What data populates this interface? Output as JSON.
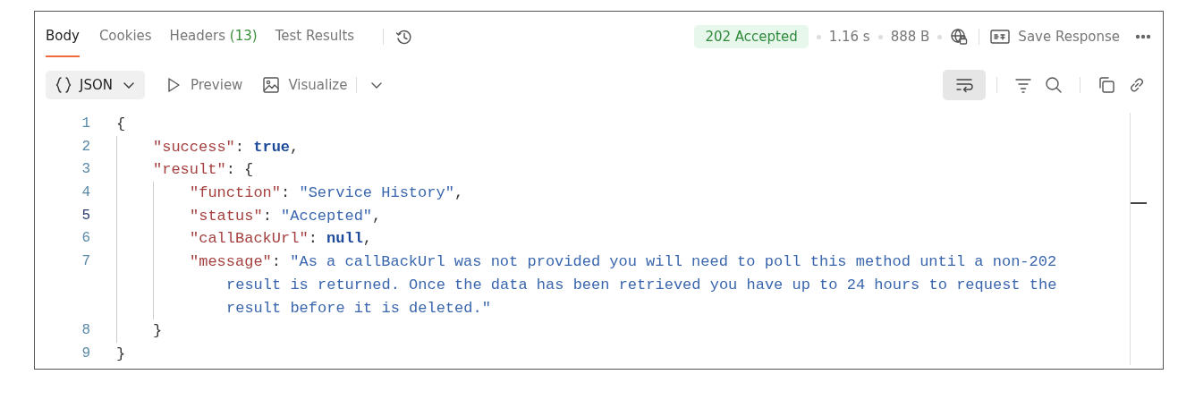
{
  "tabs": [
    {
      "label": "Body",
      "selected": true
    },
    {
      "label": "Cookies",
      "selected": false
    },
    {
      "label": "Headers",
      "count": "(13)",
      "selected": false
    },
    {
      "label": "Test Results",
      "selected": false
    }
  ],
  "status": {
    "code": "202 Accepted",
    "time": "1.16 s",
    "size": "888 B"
  },
  "save_button": {
    "label": "Save Response"
  },
  "format_dropdown": {
    "label": "JSON"
  },
  "view_buttons": [
    {
      "kind": "preview",
      "label": "Preview"
    },
    {
      "kind": "visualize",
      "label": "Visualize"
    }
  ],
  "word_wrap": {
    "on": true
  },
  "code": {
    "lines": [
      {
        "number": "1",
        "active": false,
        "tokens": [
          {
            "kind": "punct",
            "text": "{"
          }
        ],
        "children": [
          {
            "number": "2",
            "active": false,
            "tokens": [
              {
                "kind": "key",
                "text": "\"success\""
              },
              {
                "kind": "punct",
                "text": ": "
              },
              {
                "kind": "keyword",
                "text": "true"
              },
              {
                "kind": "punct",
                "text": ","
              }
            ]
          },
          {
            "number": "3",
            "active": false,
            "tokens": [
              {
                "kind": "key",
                "text": "\"result\""
              },
              {
                "kind": "punct",
                "text": ": {"
              }
            ],
            "children": [
              {
                "number": "4",
                "active": false,
                "tokens": [
                  {
                    "kind": "key",
                    "text": "\"function\""
                  },
                  {
                    "kind": "punct",
                    "text": ": "
                  },
                  {
                    "kind": "string",
                    "text": "\"Service History\""
                  },
                  {
                    "kind": "punct",
                    "text": ","
                  }
                ]
              },
              {
                "number": "5",
                "active": true,
                "tokens": [
                  {
                    "kind": "key",
                    "text": "\"status\""
                  },
                  {
                    "kind": "punct",
                    "text": ": "
                  },
                  {
                    "kind": "string",
                    "text": "\"Accepted\""
                  },
                  {
                    "kind": "punct",
                    "text": ","
                  }
                ]
              },
              {
                "number": "6",
                "active": false,
                "tokens": [
                  {
                    "kind": "key",
                    "text": "\"callBackUrl\""
                  },
                  {
                    "kind": "punct",
                    "text": ": "
                  },
                  {
                    "kind": "keyword",
                    "text": "null"
                  },
                  {
                    "kind": "punct",
                    "text": ","
                  }
                ]
              },
              {
                "number": "7",
                "active": false,
                "tokens": [
                  {
                    "kind": "key",
                    "text": "\"message\""
                  },
                  {
                    "kind": "punct",
                    "text": ": "
                  },
                  {
                    "kind": "string",
                    "text": "\"As a callBackUrl was not provided you will need to poll this method until a non-202"
                  }
                ],
                "wrap": [
                  "result is returned. Once the data has been retrieved you have up to 24 hours to request the",
                  "result before it is deleted.\""
                ]
              }
            ]
          },
          {
            "number": "8",
            "active": false,
            "tokens": [
              {
                "kind": "punct",
                "text": "}"
              }
            ]
          }
        ]
      },
      {
        "number": "9",
        "active": false,
        "tokens": [
          {
            "kind": "punct",
            "text": "}"
          }
        ]
      }
    ]
  }
}
